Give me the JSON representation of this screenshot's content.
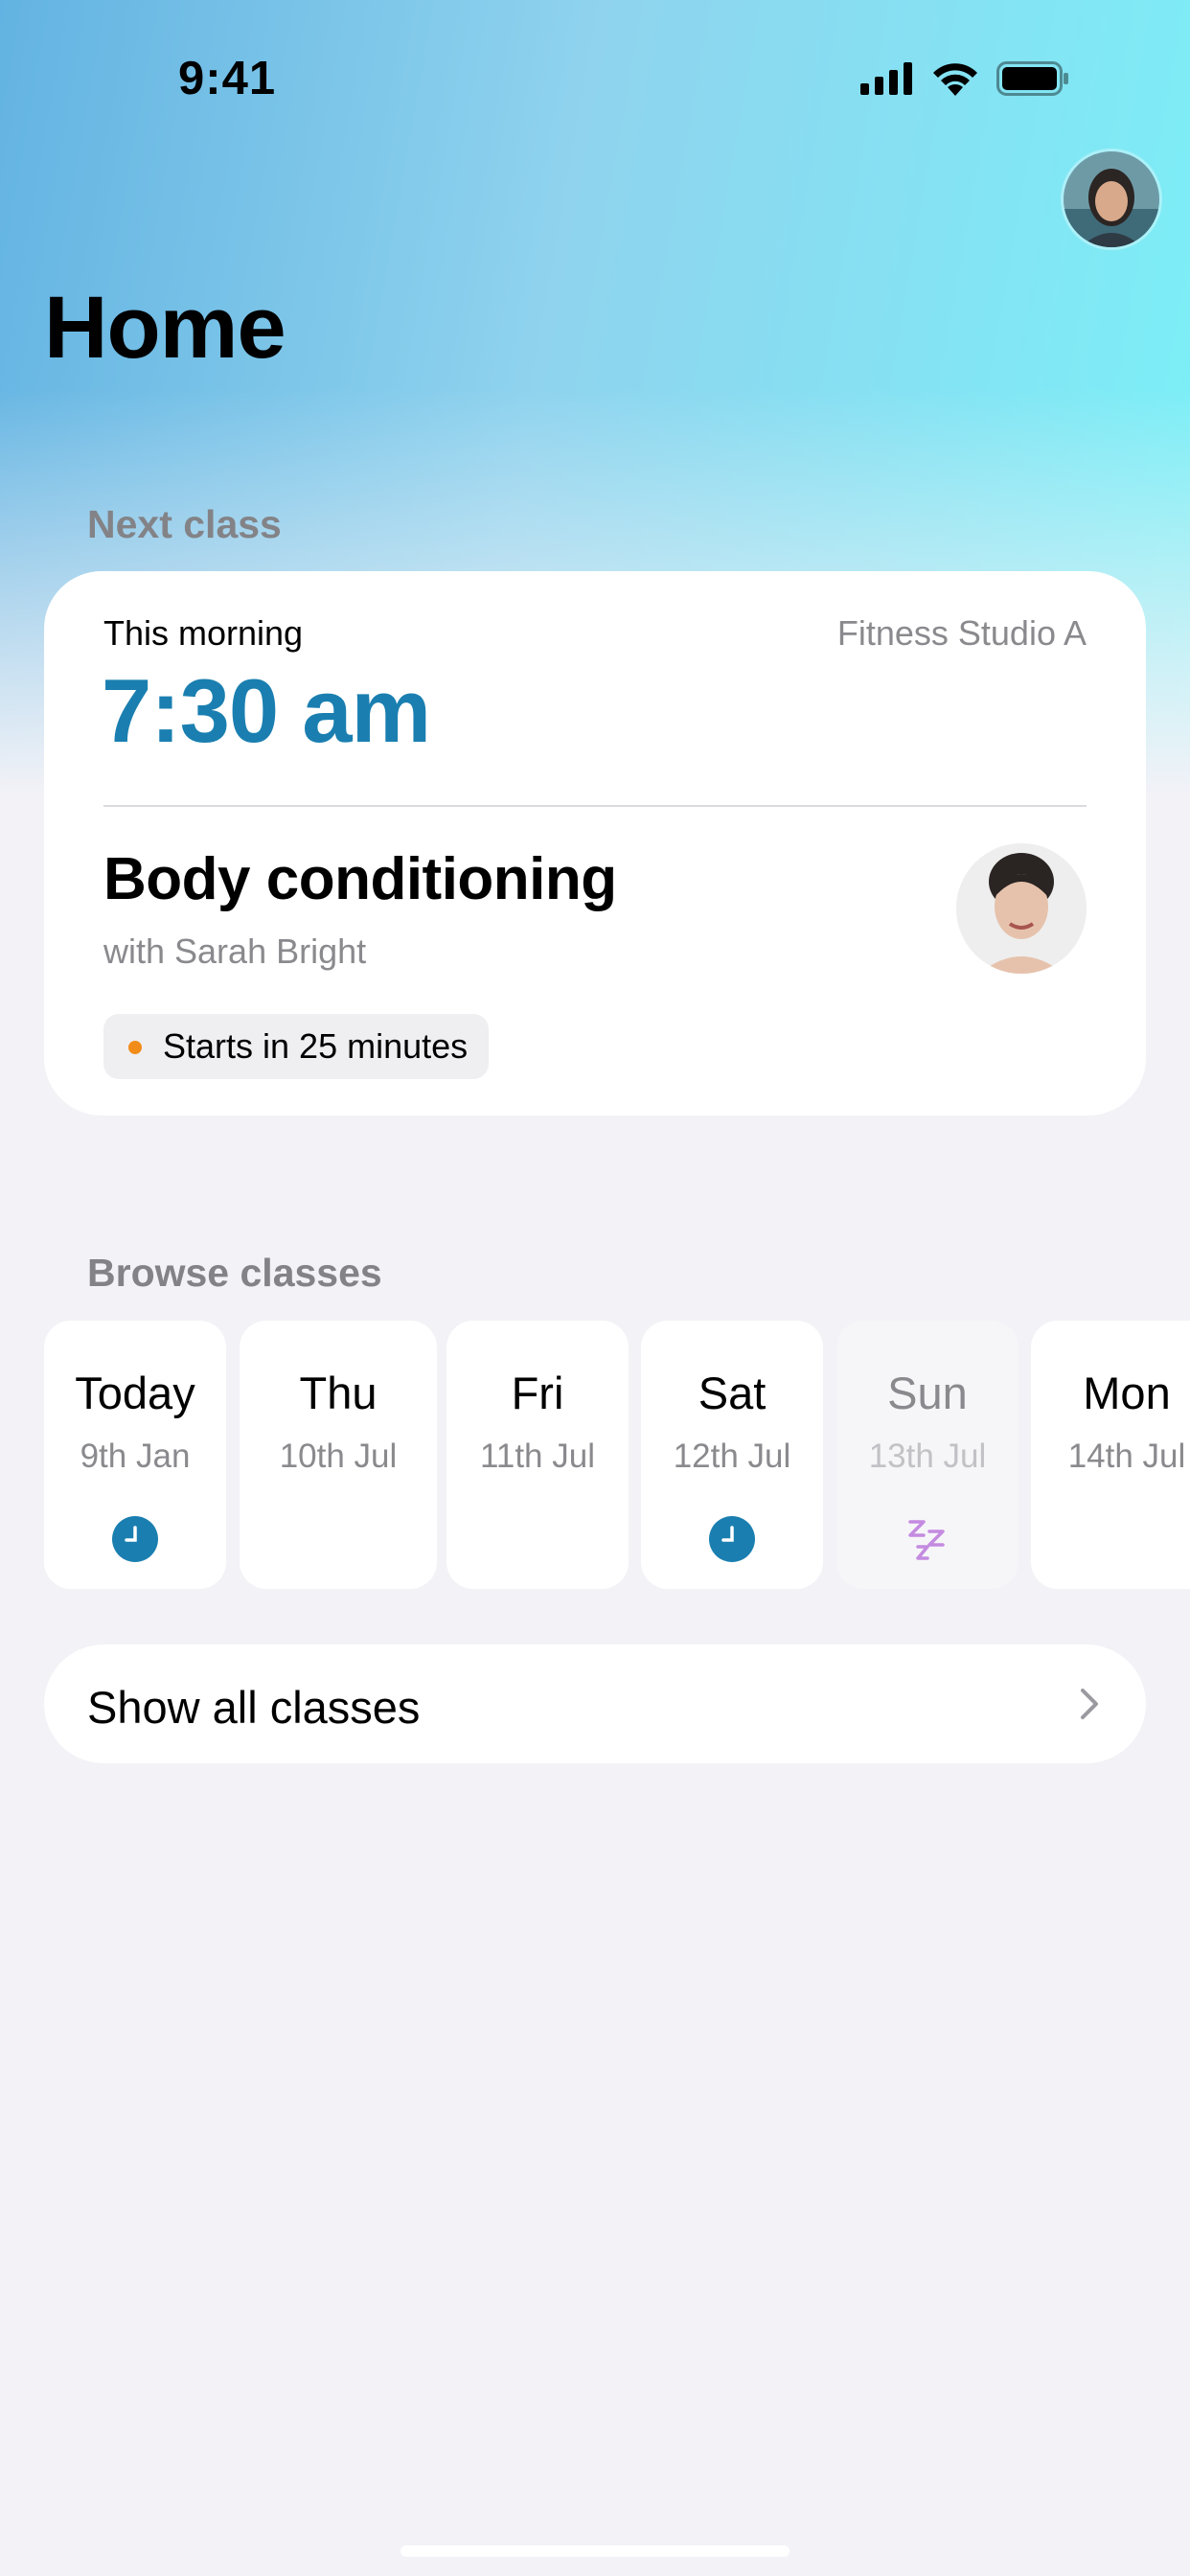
{
  "status_bar": {
    "time": "9:41"
  },
  "header": {
    "title": "Home",
    "avatar": "user-avatar"
  },
  "next_class": {
    "section_label": "Next class",
    "when": "This morning",
    "location": "Fitness Studio A",
    "time": "7:30 am",
    "class_name": "Body conditioning",
    "instructor": "with Sarah Bright",
    "status": "Starts in 25 minutes",
    "status_color": "#F28C19",
    "accent_color": "#1A7FB0"
  },
  "browse": {
    "section_label": "Browse classes",
    "days": [
      {
        "name": "Today",
        "date": "9th Jan",
        "icon": "clock-icon"
      },
      {
        "name": "Thu",
        "date": "10th Jul",
        "icon": ""
      },
      {
        "name": "Fri",
        "date": "11th Jul",
        "icon": ""
      },
      {
        "name": "Sat",
        "date": "12th Jul",
        "icon": "clock-icon"
      },
      {
        "name": "Sun",
        "date": "13th Jul",
        "icon": "sleep-icon"
      },
      {
        "name": "Mon",
        "date": "14th Jul",
        "icon": ""
      }
    ],
    "show_all_label": "Show all classes"
  }
}
